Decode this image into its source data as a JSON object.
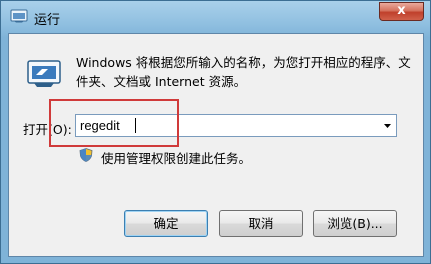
{
  "window": {
    "title": "运行",
    "close_label": "x"
  },
  "dialog": {
    "description": "Windows 将根据您所输入的名称，为您打开相应的程序、文件夹、文档或 Internet 资源。",
    "open_label": "打开(O):",
    "input_value": "regedit",
    "admin_note": "使用管理权限创建此任务。"
  },
  "buttons": {
    "ok": "确定",
    "cancel": "取消",
    "browse": "浏览(B)..."
  },
  "colors": {
    "highlight": "#d03a3a",
    "close_button": "#c0402b"
  },
  "icons": [
    "run-app-icon",
    "run-program-icon",
    "uac-shield-icon",
    "dropdown-arrow-icon"
  ]
}
